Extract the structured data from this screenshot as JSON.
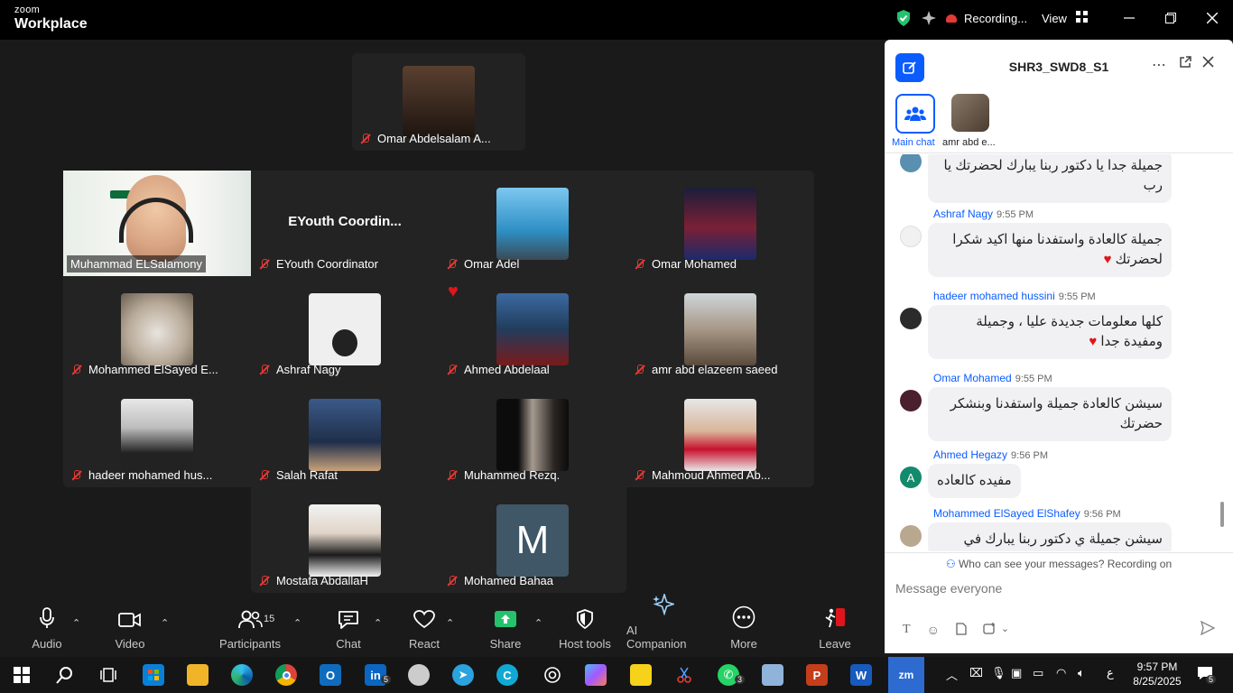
{
  "titlebar": {
    "brand_top": "zoom",
    "brand_bottom": "Workplace",
    "recording": "Recording...",
    "view": "View"
  },
  "tiles": {
    "top": "Omar Abdelsalam A...",
    "host": "Muhammad ELSalamony",
    "coord_banner": "EYouth  Coordin...",
    "coord": "EYouth Coordinator",
    "omar_adel": "Omar Adel",
    "omar_mohamed": "Omar Mohamed",
    "mohammed_elsayed": "Mohammed ElSayed E...",
    "ashraf": "Ashraf Nagy",
    "ahmed_abdelaal": "Ahmed Abdelaal",
    "amr": "amr abd elazeem saeed",
    "hadeer": "hadeer mohamed hus...",
    "salah": "Salah Rafat",
    "rezq": "Muhammed Rezq.",
    "mahmoud": "Mahmoud Ahmed Ab...",
    "mostafa": "Mostafa AbdallaH",
    "bahaa": "Mohamed Bahaa",
    "bahaa_initial": "M"
  },
  "toolbar": {
    "audio": "Audio",
    "video": "Video",
    "participants": "Participants",
    "participants_count": "15",
    "chat": "Chat",
    "react": "React",
    "share": "Share",
    "host_tools": "Host tools",
    "ai": "AI Companion",
    "more": "More",
    "leave": "Leave"
  },
  "chat": {
    "title": "SHR3_SWD8_S1",
    "tab_main": "Main chat",
    "tab_user": "amr abd e...",
    "messages": [
      {
        "name": "",
        "time": "",
        "text": "جميلة جدا يا دكتور ربنا يبارك لحضرتك يا رب"
      },
      {
        "name": "Ashraf Nagy",
        "time": "9:55 PM",
        "text": "جميلة كالعادة واستفدنا منها اكيد شكرا لحضرتك"
      },
      {
        "name": "hadeer mohamed hussini",
        "time": "9:55 PM",
        "text": "كلها معلومات جديدة عليا ، وجميلة ومفيدة جدا"
      },
      {
        "name": "Omar Mohamed",
        "time": "9:55 PM",
        "text": "سيشن كالعادة جميلة واستفدنا وبنشكر حضرتك"
      },
      {
        "name": "Ahmed Hegazy",
        "time": "9:56 PM",
        "text": "مفيده كالعاده",
        "initial": "A"
      },
      {
        "name": "Mohammed ElSayed ElShafey",
        "time": "9:56 PM",
        "text": "سيشن جميلة ي دكتور ربنا يبارك في"
      }
    ],
    "privacy": "Who can see your messages? Recording on",
    "placeholder": "Message everyone"
  },
  "taskbar": {
    "time": "9:57 PM",
    "date": "8/25/2025",
    "lang": "ع",
    "linkedin_badge": "5",
    "whatsapp_badge": "3",
    "notif_badge": "5"
  },
  "colors": {
    "accent": "#0b5cff",
    "muted_red": "#e53935",
    "share_green": "#25c26e"
  }
}
